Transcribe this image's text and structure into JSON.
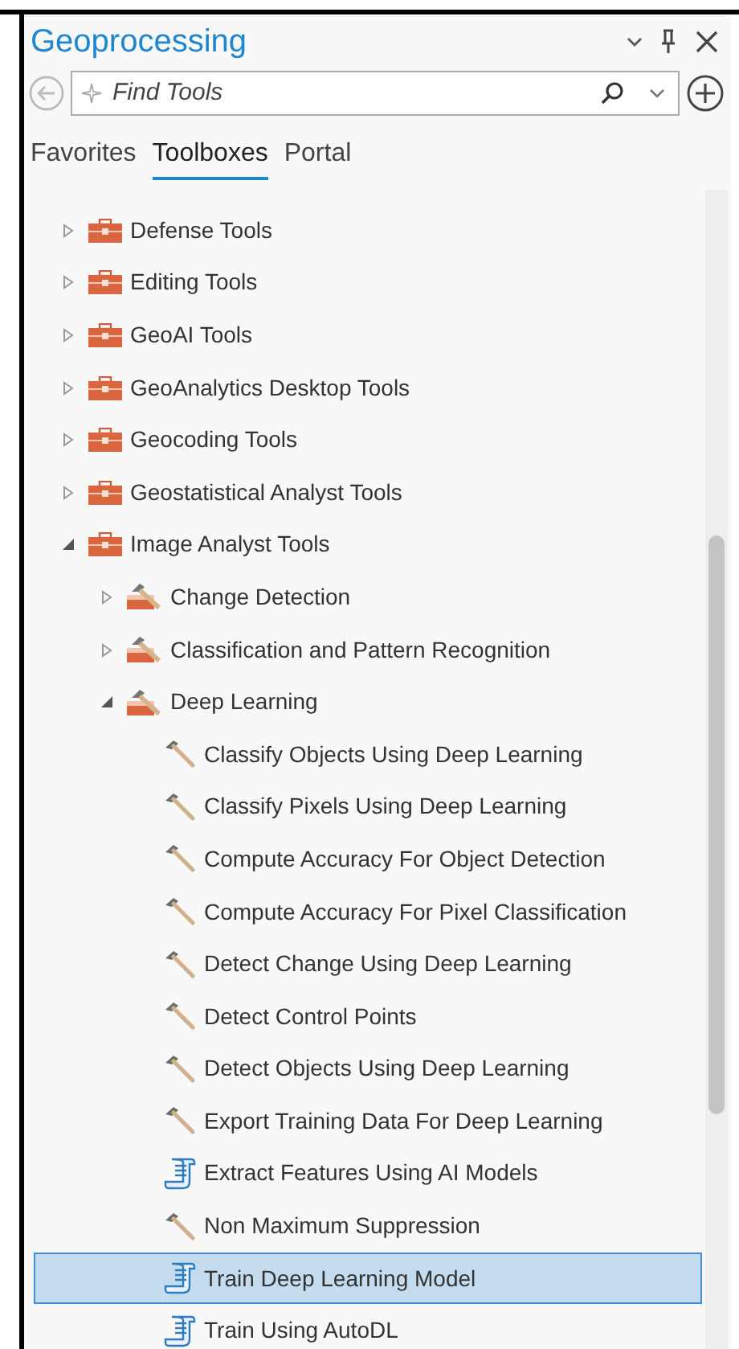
{
  "pane": {
    "title": "Geoprocessing"
  },
  "search": {
    "placeholder": "Find Tools"
  },
  "tabs": [
    {
      "label": "Favorites",
      "selected": false
    },
    {
      "label": "Toolboxes",
      "selected": true
    },
    {
      "label": "Portal",
      "selected": false
    }
  ],
  "tree": [
    {
      "kind": "toolbox",
      "label": "Defense Tools",
      "expanded": false,
      "selected": false
    },
    {
      "kind": "toolbox",
      "label": "Editing Tools",
      "expanded": false,
      "selected": false
    },
    {
      "kind": "toolbox",
      "label": "GeoAI Tools",
      "expanded": false,
      "selected": false
    },
    {
      "kind": "toolbox",
      "label": "GeoAnalytics Desktop Tools",
      "expanded": false,
      "selected": false
    },
    {
      "kind": "toolbox",
      "label": "Geocoding Tools",
      "expanded": false,
      "selected": false
    },
    {
      "kind": "toolbox",
      "label": "Geostatistical Analyst Tools",
      "expanded": false,
      "selected": false
    },
    {
      "kind": "toolbox",
      "label": "Image Analyst Tools",
      "expanded": true,
      "selected": false,
      "children": [
        {
          "kind": "toolset",
          "label": "Change Detection",
          "expanded": false,
          "selected": false
        },
        {
          "kind": "toolset",
          "label": "Classification and Pattern Recognition",
          "expanded": false,
          "selected": false
        },
        {
          "kind": "toolset",
          "label": "Deep Learning",
          "expanded": true,
          "selected": false,
          "children": [
            {
              "kind": "tool",
              "label": "Classify Objects Using Deep Learning",
              "selected": false
            },
            {
              "kind": "tool",
              "label": "Classify Pixels Using Deep Learning",
              "selected": false
            },
            {
              "kind": "tool",
              "label": "Compute Accuracy For Object Detection",
              "selected": false
            },
            {
              "kind": "tool",
              "label": "Compute Accuracy For Pixel Classification",
              "selected": false
            },
            {
              "kind": "tool",
              "label": "Detect Change Using Deep Learning",
              "selected": false
            },
            {
              "kind": "tool",
              "label": "Detect Control Points",
              "selected": false
            },
            {
              "kind": "tool",
              "label": "Detect Objects Using Deep Learning",
              "selected": false
            },
            {
              "kind": "tool",
              "label": "Export Training Data For Deep Learning",
              "selected": false
            },
            {
              "kind": "script",
              "label": "Extract Features Using AI Models",
              "selected": false
            },
            {
              "kind": "tool",
              "label": "Non Maximum Suppression",
              "selected": false
            },
            {
              "kind": "script",
              "label": "Train Deep Learning Model",
              "selected": true
            },
            {
              "kind": "script",
              "label": "Train Using AutoDL",
              "selected": false
            }
          ]
        }
      ]
    }
  ]
}
